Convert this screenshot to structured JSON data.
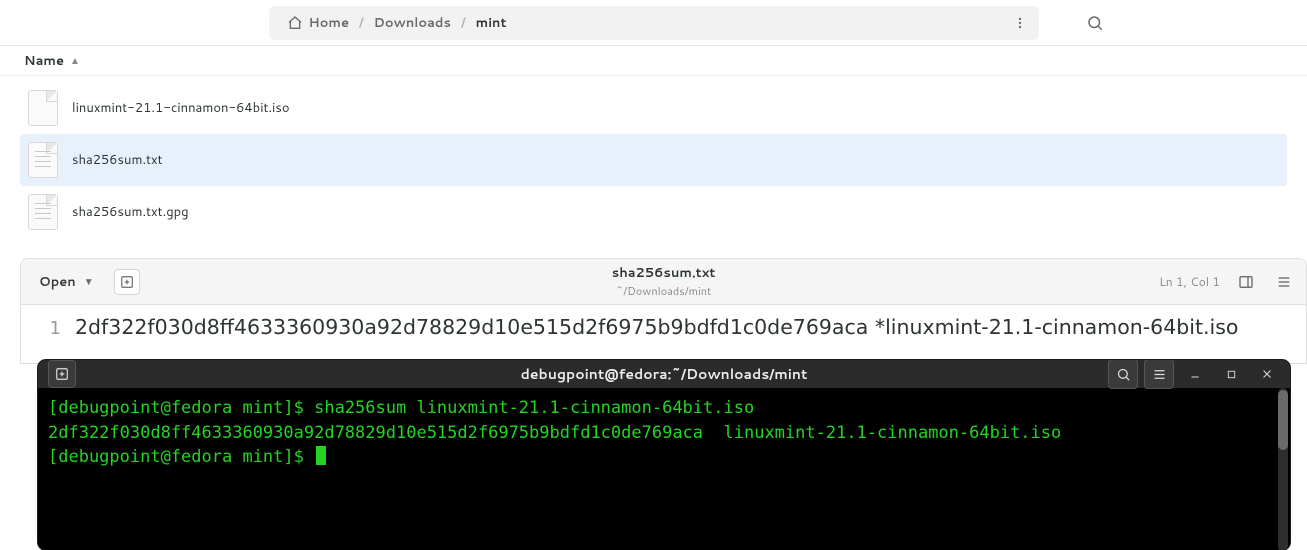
{
  "filemanager": {
    "breadcrumb": {
      "home_label": "Home",
      "mid_label": "Downloads",
      "current_label": "mint"
    },
    "column_header": "Name",
    "files": [
      {
        "name": "linuxmint-21.1-cinnamon-64bit.iso",
        "selected": false,
        "kind": "blank"
      },
      {
        "name": "sha256sum.txt",
        "selected": true,
        "kind": "text"
      },
      {
        "name": "sha256sum.txt.gpg",
        "selected": false,
        "kind": "text"
      }
    ]
  },
  "editor": {
    "open_label": "Open",
    "doc_title": "sha256sum.txt",
    "doc_subtitle": "~/Downloads/mint",
    "status_lncol": "Ln 1, Col 1",
    "line_number": "1",
    "line_text": "2df322f030d8ff4633360930a92d78829d10e515d2f6975b9bdfd1c0de769aca *linuxmint-21.1-cinnamon-64bit.iso"
  },
  "terminal": {
    "title": "debugpoint@fedora:~/Downloads/mint",
    "lines": [
      "[debugpoint@fedora mint]$ sha256sum linuxmint-21.1-cinnamon-64bit.iso",
      "2df322f030d8ff4633360930a92d78829d10e515d2f6975b9bdfd1c0de769aca  linuxmint-21.1-cinnamon-64bit.iso",
      "[debugpoint@fedora mint]$ "
    ]
  }
}
